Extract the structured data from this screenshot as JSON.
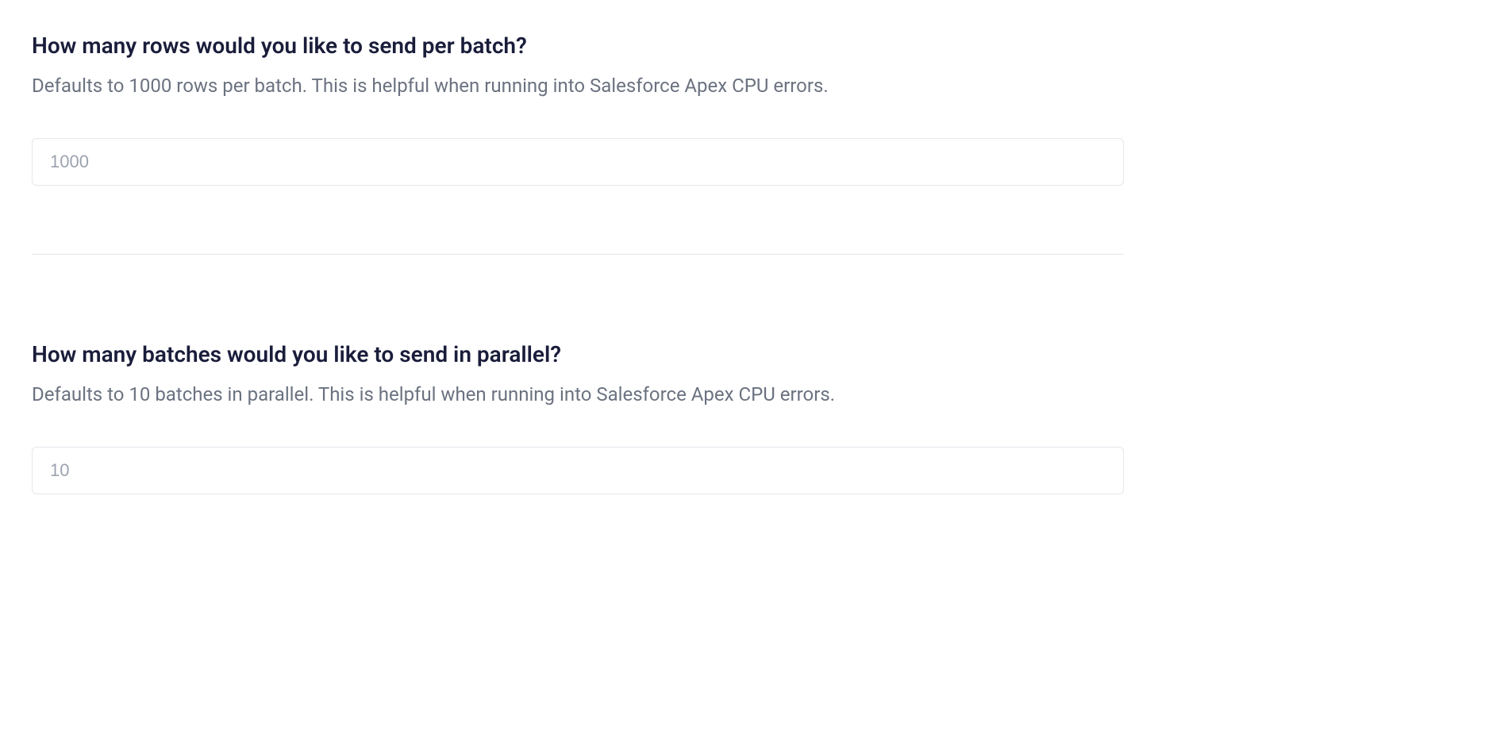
{
  "sections": [
    {
      "heading": "How many rows would you like to send per batch?",
      "description": "Defaults to 1000 rows per batch. This is helpful when running into Salesforce Apex CPU errors.",
      "placeholder": "1000",
      "value": ""
    },
    {
      "heading": "How many batches would you like to send in parallel?",
      "description": "Defaults to 10 batches in parallel. This is helpful when running into Salesforce Apex CPU errors.",
      "placeholder": "10",
      "value": ""
    }
  ]
}
